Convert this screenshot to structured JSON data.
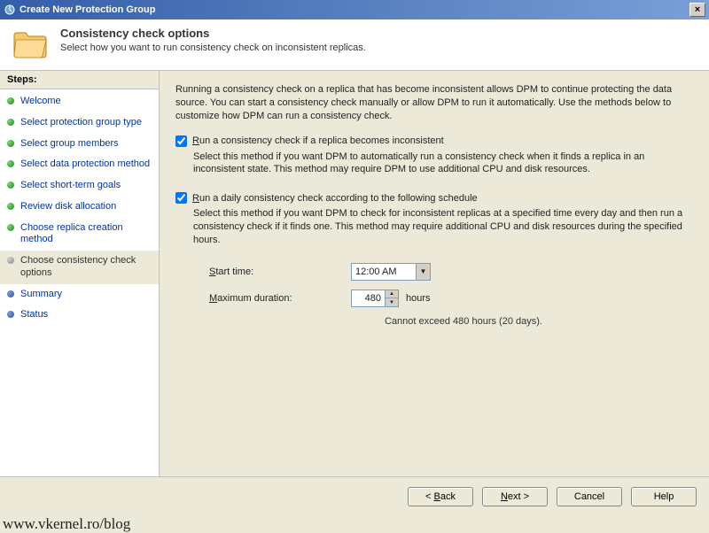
{
  "window": {
    "title": "Create New Protection Group",
    "close": "×"
  },
  "header": {
    "title": "Consistency check options",
    "subtitle": "Select how you want to run consistency check on inconsistent replicas."
  },
  "sidebar": {
    "heading": "Steps:",
    "items": [
      {
        "label": "Welcome",
        "state": "done"
      },
      {
        "label": "Select protection group type",
        "state": "done"
      },
      {
        "label": "Select group members",
        "state": "done"
      },
      {
        "label": "Select data protection method",
        "state": "done"
      },
      {
        "label": "Select short-term goals",
        "state": "done"
      },
      {
        "label": "Review disk allocation",
        "state": "done"
      },
      {
        "label": "Choose replica creation method",
        "state": "done"
      },
      {
        "label": "Choose consistency check options",
        "state": "current"
      },
      {
        "label": "Summary",
        "state": "pending"
      },
      {
        "label": "Status",
        "state": "pending"
      }
    ]
  },
  "main": {
    "intro": "Running a consistency check on a replica that has become inconsistent allows DPM to continue protecting the data source. You can start a consistency check manually or allow DPM to run it automatically. Use the methods below to customize how DPM can run a consistency check.",
    "option1": {
      "checked": true,
      "label_pre": "R",
      "label_rest": "un a consistency check if a replica becomes inconsistent",
      "desc": "Select this method if you want DPM to automatically run a consistency check when it finds a replica in an inconsistent state. This method may require DPM to use additional CPU and disk resources."
    },
    "option2": {
      "checked": true,
      "label_pre": "R",
      "label_rest": "un a daily consistency check according to the following schedule",
      "desc": "Select this method if you want DPM to check for inconsistent replicas at a specified time every day and then run a consistency check if it finds one. This method may require additional CPU and disk resources during the specified hours."
    },
    "schedule": {
      "start_label_pre": "S",
      "start_label_rest": "tart time:",
      "start_value": "12:00 AM",
      "dur_label_pre": "M",
      "dur_label_rest": "aximum duration:",
      "dur_value": "480",
      "dur_unit": "hours",
      "note": "Cannot exceed 480 hours (20 days)."
    }
  },
  "buttons": {
    "back_pre": "< ",
    "back_u": "B",
    "back_rest": "ack",
    "next_u": "N",
    "next_rest": "ext >",
    "cancel": "Cancel",
    "help": "Help"
  },
  "watermark": "www.vkernel.ro/blog"
}
